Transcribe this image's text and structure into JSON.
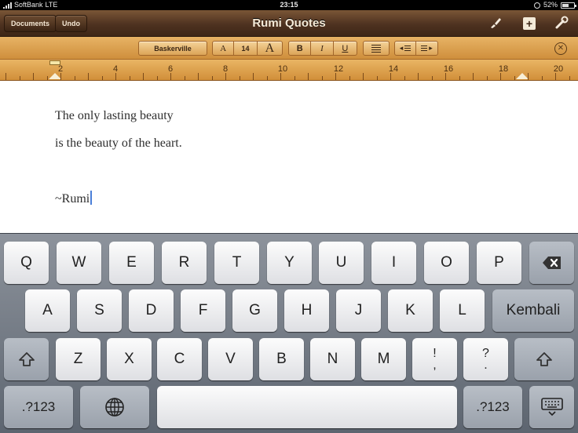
{
  "status": {
    "carrier": "SoftBank",
    "network": "LTE",
    "time": "23:15",
    "battery": "52%",
    "battery_fraction": 0.52
  },
  "toolbar": {
    "documents_label": "Documents",
    "undo_label": "Undo",
    "title": "Rumi Quotes",
    "brush_icon": "paintbrush-icon",
    "add_icon": "plus-icon",
    "tools_icon": "wrench-icon"
  },
  "format": {
    "font": "Baskerville",
    "size_down": "A",
    "size": "14",
    "size_up": "A",
    "bold": "B",
    "italic": "I",
    "underline": "U",
    "indent_left": "◂",
    "indent_right": "▸",
    "close": "✕"
  },
  "ruler": {
    "labels": [
      "2",
      "4",
      "6",
      "8",
      "10",
      "12",
      "14",
      "16",
      "18",
      "20"
    ]
  },
  "document": {
    "lines": [
      "The only lasting beauty",
      "is the beauty of the heart.",
      "~Rumi"
    ]
  },
  "keyboard": {
    "row1": [
      "Q",
      "W",
      "E",
      "R",
      "T",
      "Y",
      "U",
      "I",
      "O",
      "P"
    ],
    "row2": [
      "A",
      "S",
      "D",
      "F",
      "G",
      "H",
      "J",
      "K",
      "L"
    ],
    "return_label": "Kembali",
    "row3": [
      "Z",
      "X",
      "C",
      "V",
      "B",
      "N",
      "M"
    ],
    "punct1_top": "!",
    "punct1_bottom": ",",
    "punct2_top": "?",
    "punct2_bottom": ".",
    "numbers_label": ".?123",
    "shift_glyph": "⇧",
    "globe_glyph": "🌐",
    "backspace_glyph": "⌫"
  },
  "colors": {
    "leather": "#4e3220",
    "ribbon": "#d99c4a",
    "caret": "#4a7fd8"
  }
}
